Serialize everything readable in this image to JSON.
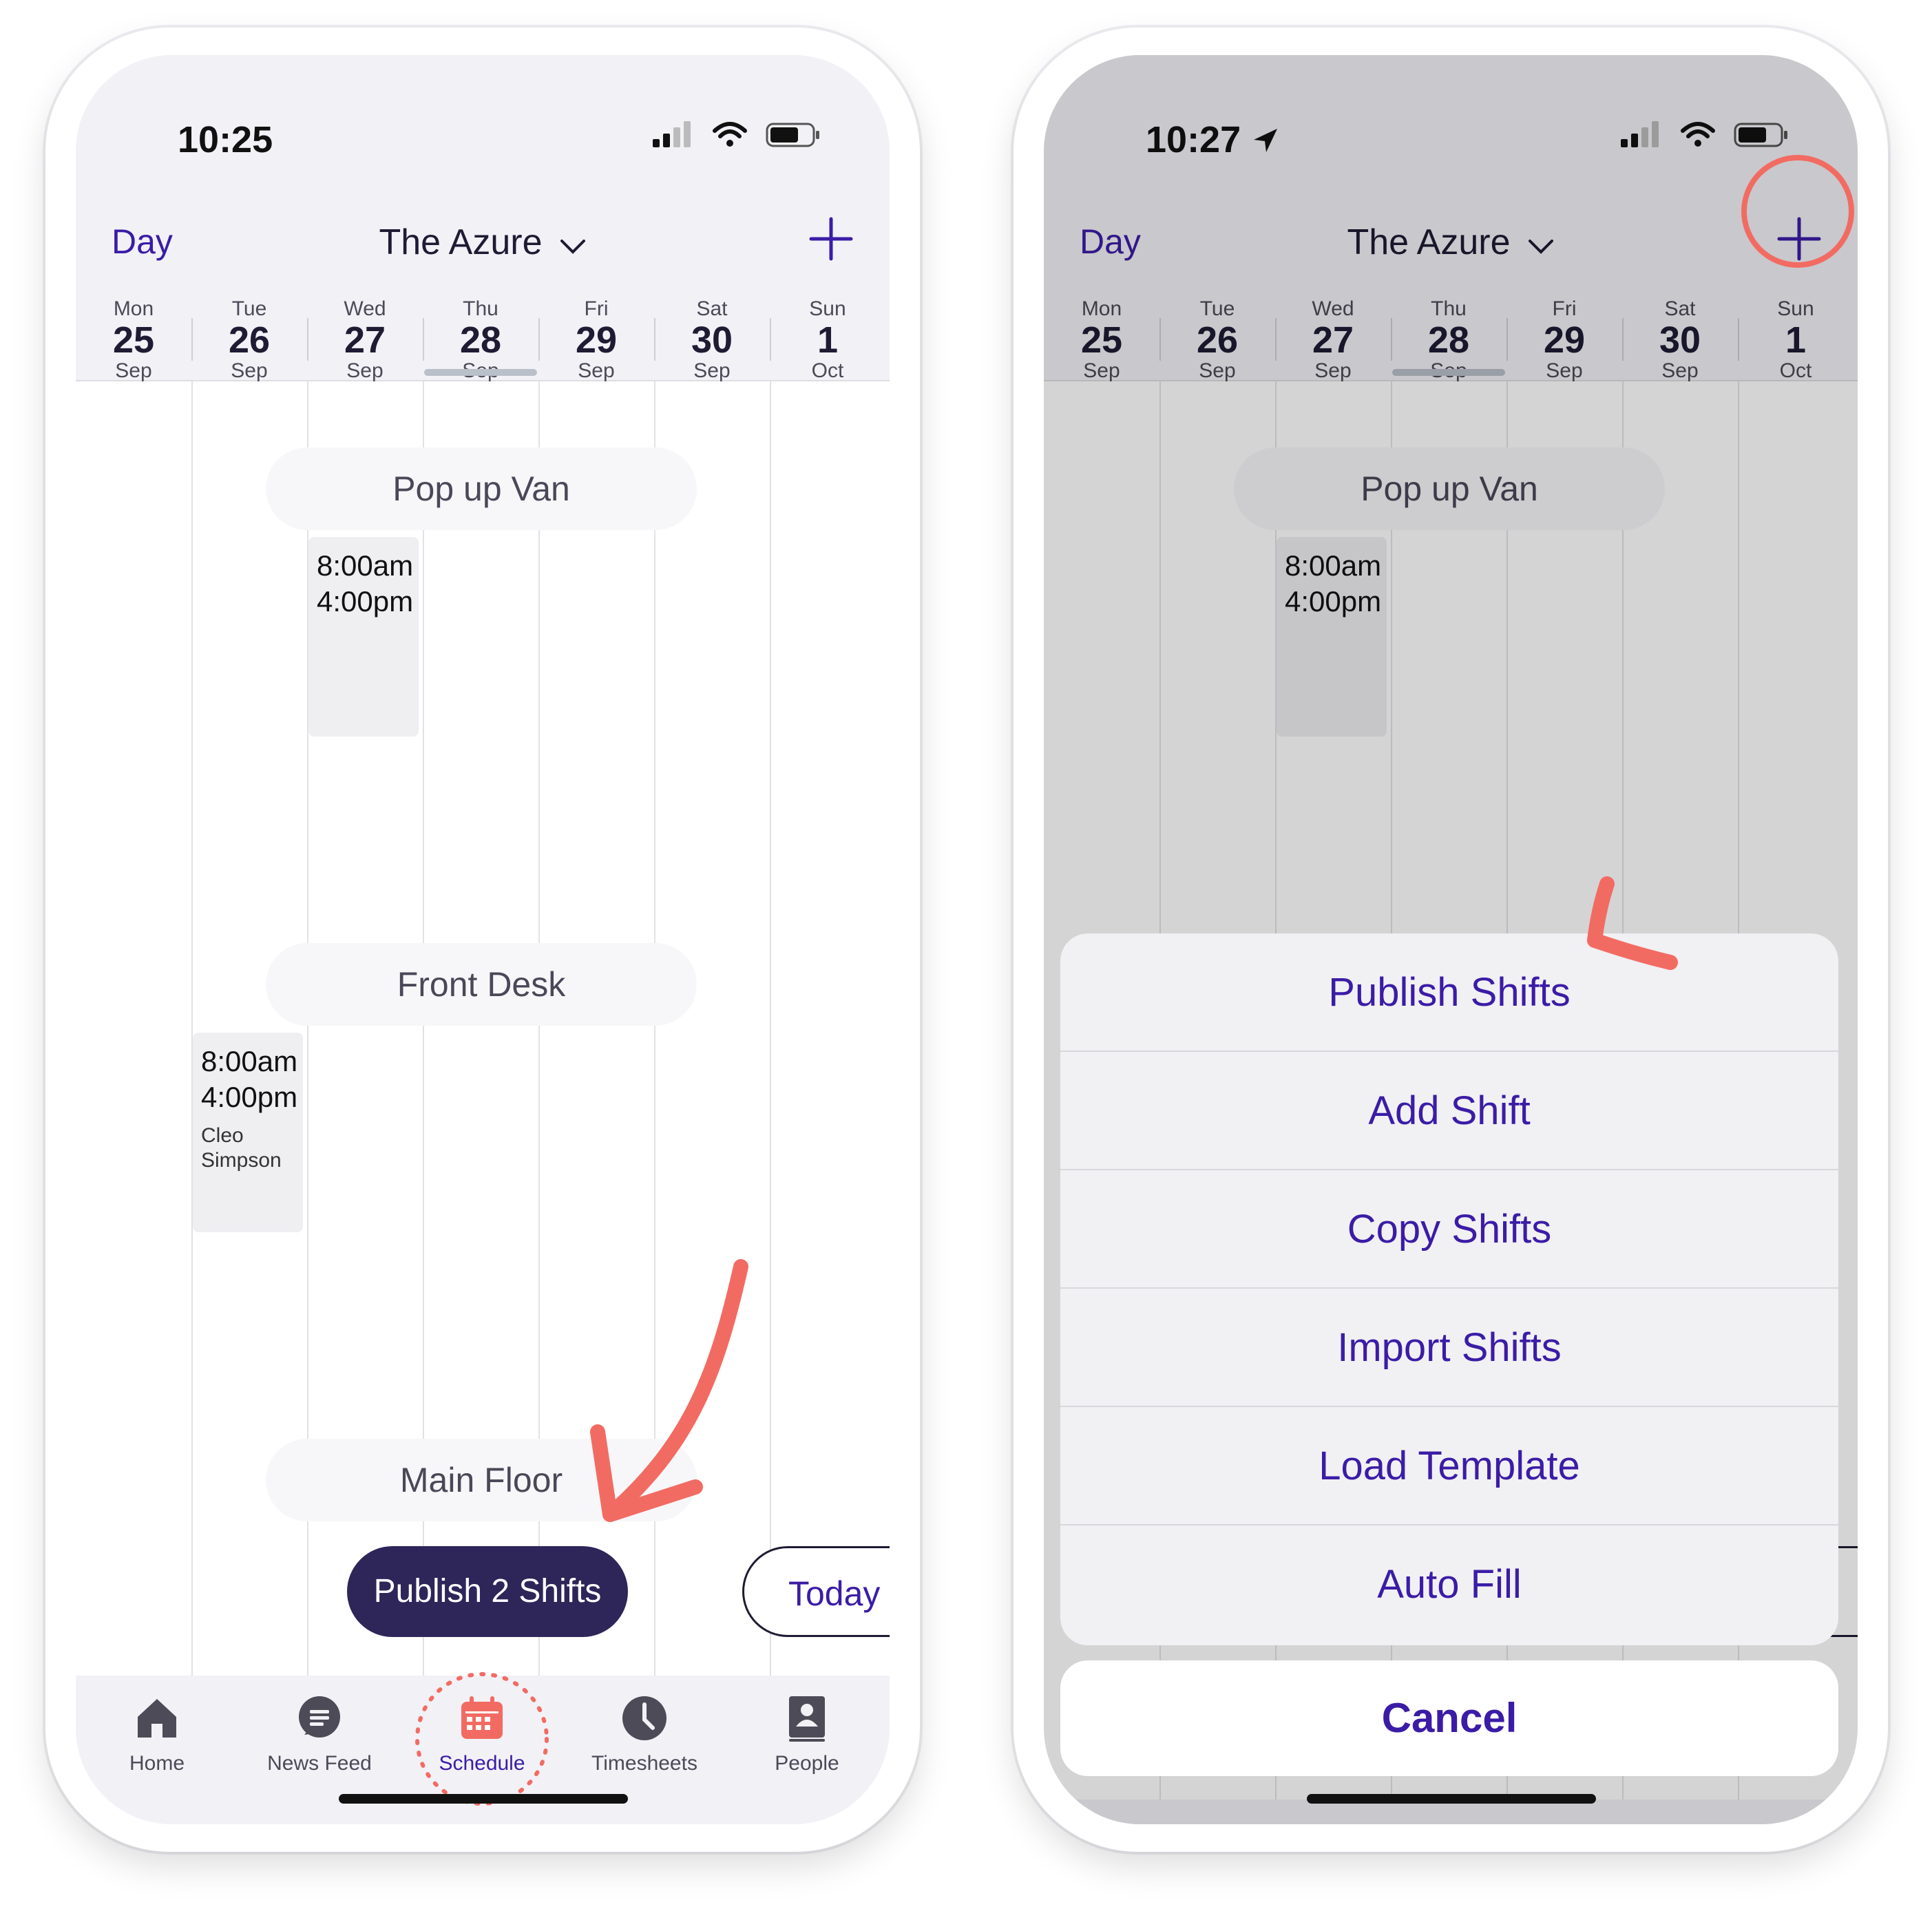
{
  "left_phone": {
    "status_time": "10:25",
    "header": {
      "day_link": "Day",
      "venue": "The Azure"
    },
    "days": [
      {
        "wd": "Mon",
        "dn": "25",
        "mo": "Sep"
      },
      {
        "wd": "Tue",
        "dn": "26",
        "mo": "Sep"
      },
      {
        "wd": "Wed",
        "dn": "27",
        "mo": "Sep"
      },
      {
        "wd": "Thu",
        "dn": "28",
        "mo": "Sep"
      },
      {
        "wd": "Fri",
        "dn": "29",
        "mo": "Sep"
      },
      {
        "wd": "Sat",
        "dn": "30",
        "mo": "Sep"
      },
      {
        "wd": "Sun",
        "dn": "1",
        "mo": "Oct"
      }
    ],
    "groups": [
      "Pop up Van",
      "Front Desk",
      "Main Floor"
    ],
    "shifts": [
      {
        "start": "8:00am",
        "end": "4:00pm",
        "name": ""
      },
      {
        "start": "8:00am",
        "end": "4:00pm",
        "name_line1": "Cleo",
        "name_line2": "Simpson"
      }
    ],
    "publish_button": "Publish 2 Shifts",
    "today_button": "Today",
    "tabs": [
      "Home",
      "News Feed",
      "Schedule",
      "Timesheets",
      "People"
    ]
  },
  "right_phone": {
    "status_time": "10:27",
    "header": {
      "day_link": "Day",
      "venue": "The Azure"
    },
    "groups": [
      "Pop up Van"
    ],
    "shift": {
      "start": "8:00am",
      "end": "4:00pm"
    },
    "action_sheet": {
      "items": [
        "Publish Shifts",
        "Add Shift",
        "Copy Shifts",
        "Import Shifts",
        "Load Template",
        "Auto Fill"
      ],
      "cancel": "Cancel"
    }
  },
  "colors": {
    "accent": "#3b1ca6",
    "publish_bg": "#2e2559",
    "annotation": "#f26b63",
    "active_tab": "#f26b63"
  }
}
